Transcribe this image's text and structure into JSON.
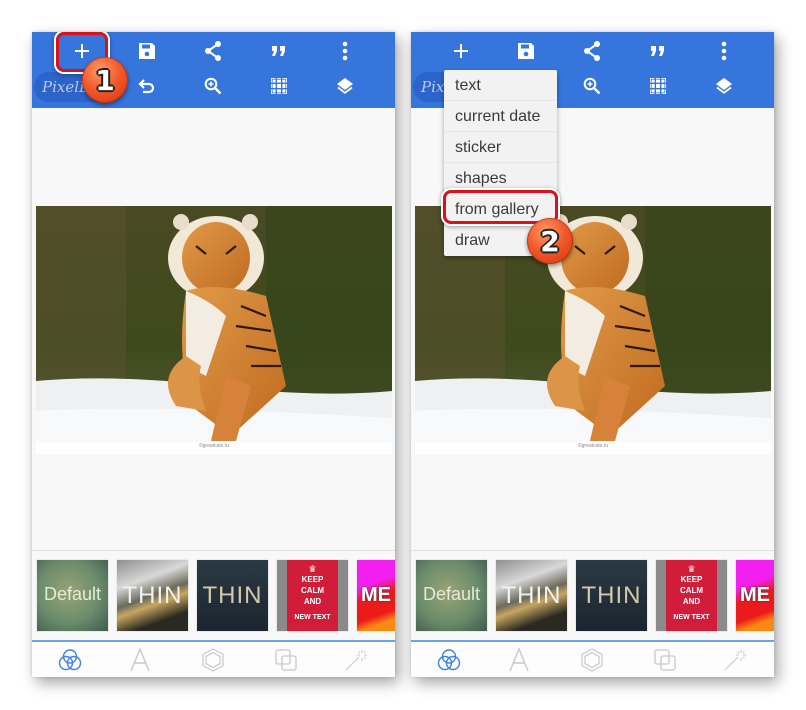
{
  "colors": {
    "header_blue": "#3675dc",
    "highlight_red": "#d9121b",
    "badge_orange": "#f25a2a",
    "nav_active_blue": "#3d82e6",
    "nav_inactive_gray": "#c8c8c8"
  },
  "app": {
    "logo_text": "PixelLab"
  },
  "toolbar": {
    "row1": [
      {
        "name": "add",
        "icon": "plus-icon"
      },
      {
        "name": "save",
        "icon": "save-icon"
      },
      {
        "name": "share",
        "icon": "share-icon"
      },
      {
        "name": "quote",
        "icon": "quote-icon"
      },
      {
        "name": "more",
        "icon": "more-vertical-icon"
      }
    ],
    "row2": [
      {
        "name": "undo",
        "icon": "undo-icon"
      },
      {
        "name": "zoom",
        "icon": "zoom-in-icon"
      },
      {
        "name": "grid",
        "icon": "grid-icon"
      },
      {
        "name": "layers",
        "icon": "layers-icon"
      }
    ]
  },
  "canvas": {
    "image_subject": "Siberian tiger running in snow",
    "caption": "©greatcats.ru"
  },
  "templates": [
    {
      "label": "Default"
    },
    {
      "label": "THIN"
    },
    {
      "label": "THIN"
    },
    {
      "label_lines": [
        "KEEP",
        "CALM",
        "AND",
        "NEW TEXT"
      ]
    },
    {
      "label": "ME"
    }
  ],
  "bottom_nav": [
    {
      "name": "blend",
      "icon": "circles-icon",
      "active": true
    },
    {
      "name": "text",
      "icon": "letter-a-icon",
      "active": false
    },
    {
      "name": "shapes",
      "icon": "hexagon-icon",
      "active": false
    },
    {
      "name": "layers",
      "icon": "overlap-squares-icon",
      "active": false
    },
    {
      "name": "effects",
      "icon": "magic-wand-icon",
      "active": false
    }
  ],
  "add_menu": {
    "items": [
      "text",
      "current date",
      "sticker",
      "shapes",
      "from gallery",
      "draw"
    ],
    "highlighted": "from gallery"
  },
  "annotations": {
    "step1": "1",
    "step2": "2"
  }
}
